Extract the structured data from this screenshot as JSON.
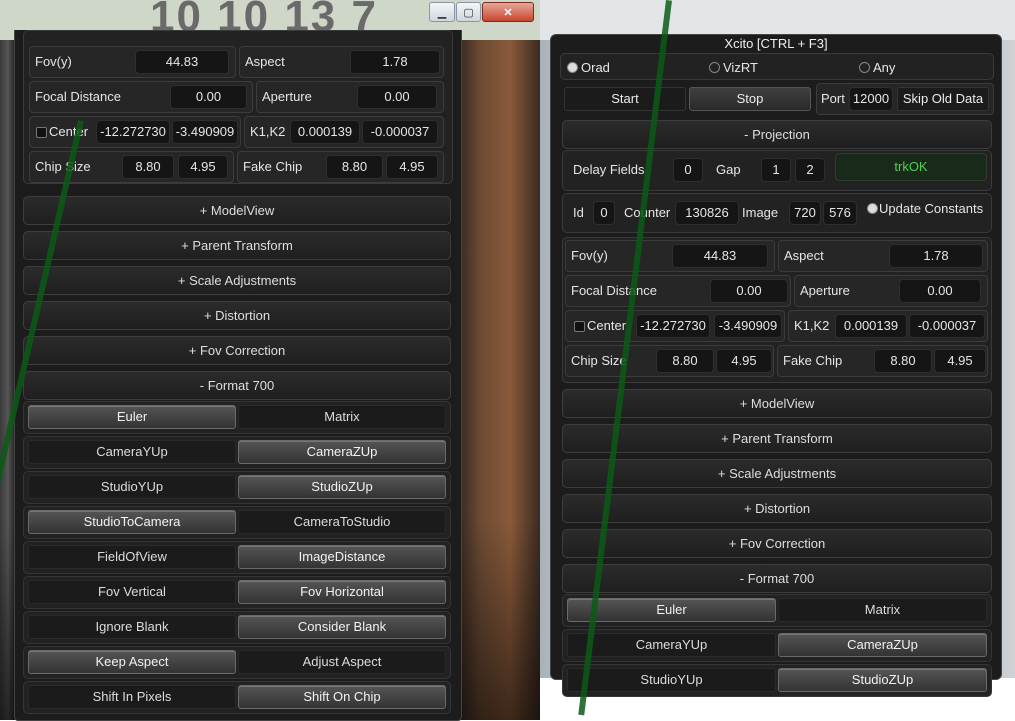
{
  "background_digits": "10 10 13 7",
  "window_controls": {
    "minimize_icon": "minimize-icon",
    "maximize_icon": "maximize-icon",
    "close_icon": "close-icon",
    "close_glyph": "✕"
  },
  "left": {
    "fov_label": "Fov(y)",
    "fov_value": "44.83",
    "aspect_label": "Aspect",
    "aspect_value": "1.78",
    "focal_label": "Focal Distance",
    "focal_value": "0.00",
    "aperture_label": "Aperture",
    "aperture_value": "0.00",
    "center_label": "Center",
    "center_x": "-12.272730",
    "center_y": "-3.490909",
    "k_label": "K1,K2",
    "k1": "0.000139",
    "k2": "-0.000037",
    "chip_label": "Chip Size",
    "chip_w": "8.80",
    "chip_h": "4.95",
    "fake_chip_label": "Fake Chip",
    "fake_w": "8.80",
    "fake_h": "4.95",
    "sections": [
      "+ ModelView",
      "+ Parent Transform",
      "+ Scale Adjustments",
      "+ Distortion",
      "+ Fov Correction",
      "- Format 700"
    ],
    "options": [
      {
        "a": "Euler",
        "b": "Matrix",
        "sel": "a"
      },
      {
        "a": "CameraYUp",
        "b": "CameraZUp",
        "sel": "b"
      },
      {
        "a": "StudioYUp",
        "b": "StudioZUp",
        "sel": "b"
      },
      {
        "a": "StudioToCamera",
        "b": "CameraToStudio",
        "sel": "a"
      },
      {
        "a": "FieldOfView",
        "b": "ImageDistance",
        "sel": "b"
      },
      {
        "a": "Fov Vertical",
        "b": "Fov Horizontal",
        "sel": "b"
      },
      {
        "a": "Ignore Blank",
        "b": "Consider Blank",
        "sel": "b"
      },
      {
        "a": "Keep Aspect",
        "b": "Adjust Aspect",
        "sel": "a"
      },
      {
        "a": "Shift In Pixels",
        "b": "Shift On Chip",
        "sel": "b"
      }
    ]
  },
  "right": {
    "title": "Xcito [CTRL + F3]",
    "radio_orad": "Orad",
    "radio_vizrt": "VizRT",
    "radio_any": "Any",
    "start_label": "Start",
    "stop_label": "Stop",
    "port_label": "Port",
    "port_value": "12000",
    "skip_label": "Skip Old Data",
    "projection_label": "- Projection",
    "delay_label": "Delay Fields",
    "delay_value": "0",
    "gap_label": "Gap",
    "gap_a": "1",
    "gap_b": "2",
    "status": "trkOK",
    "id_label": "Id",
    "id_value": "0",
    "counter_label": "Counter",
    "counter_value": "130826",
    "image_label": "Image",
    "image_w": "720",
    "image_h": "576",
    "update_label": "Update Constants",
    "fov_label": "Fov(y)",
    "fov_value": "44.83",
    "aspect_label": "Aspect",
    "aspect_value": "1.78",
    "focal_label": "Focal Distance",
    "focal_value": "0.00",
    "aperture_label": "Aperture",
    "aperture_value": "0.00",
    "center_label": "Center",
    "center_x": "-12.272730",
    "center_y": "-3.490909",
    "k_label": "K1,K2",
    "k1": "0.000139",
    "k2": "-0.000037",
    "chip_label": "Chip Size",
    "chip_w": "8.80",
    "chip_h": "4.95",
    "fake_chip_label": "Fake Chip",
    "fake_w": "8.80",
    "fake_h": "4.95",
    "sections": [
      "+ ModelView",
      "+ Parent Transform",
      "+ Scale Adjustments",
      "+ Distortion",
      "+ Fov Correction",
      "- Format 700"
    ],
    "options": [
      {
        "a": "Euler",
        "b": "Matrix",
        "sel": "a"
      },
      {
        "a": "CameraYUp",
        "b": "CameraZUp",
        "sel": "b"
      },
      {
        "a": "StudioYUp",
        "b": "StudioZUp",
        "sel": "b"
      }
    ]
  }
}
